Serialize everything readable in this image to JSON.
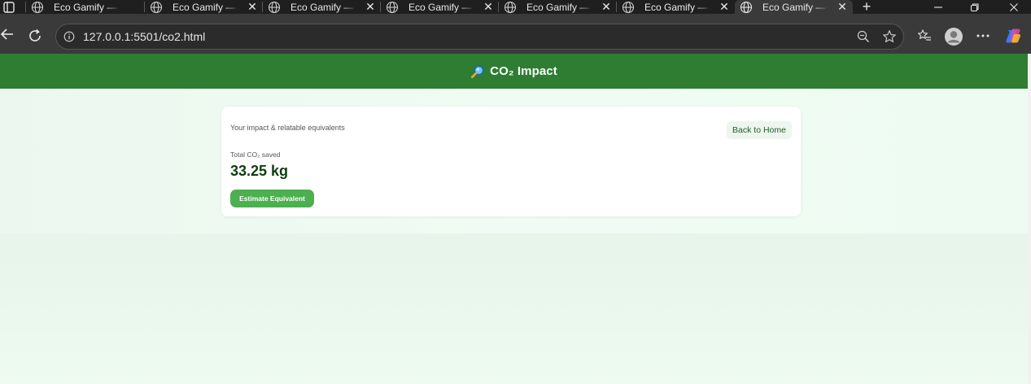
{
  "browser": {
    "tabs": [
      {
        "title": "Eco Gamify — E",
        "active": false
      },
      {
        "title": "Eco Gamify — V",
        "active": false
      },
      {
        "title": "Eco Gamify — V",
        "active": false
      },
      {
        "title": "Eco Gamify — V",
        "active": false
      },
      {
        "title": "Eco Gamify — V",
        "active": false
      },
      {
        "title": "Eco Gamify — V",
        "active": false
      },
      {
        "title": "Eco Gamify — C",
        "active": true
      }
    ],
    "url": "127.0.0.1:5501/co2.html",
    "new_tab_symbol": "+",
    "close_symbol": "✕"
  },
  "page": {
    "header_title": "CO₂ Impact",
    "header_icon": "magnifier-icon",
    "card": {
      "subtitle": "Your impact & relatable equivalents",
      "back_button": "Back to Home",
      "total_label": "Total CO₂ saved",
      "total_value": "33.25 kg",
      "estimate_button": "Estimate Equivalent"
    }
  },
  "colors": {
    "header_bg": "#2e7d32",
    "primary_button": "#4caf50",
    "value_text": "#0f3d12"
  }
}
